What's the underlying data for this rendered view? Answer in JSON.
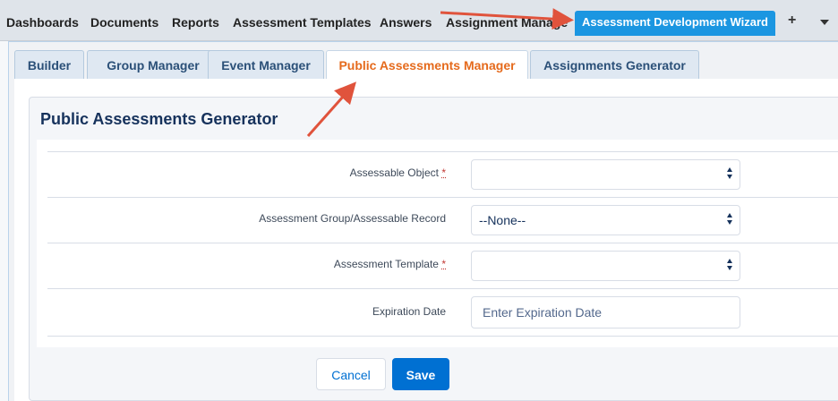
{
  "topnav": {
    "tabs": [
      "Dashboards",
      "Documents",
      "Reports",
      "Assessment Templates",
      "Answers",
      "Assignment Manage"
    ],
    "active_tab": "Assessment Development Wizard",
    "plus": "+",
    "active_color": "#1b96e1"
  },
  "subtabs": {
    "items": [
      "Builder",
      "Group Manager",
      "Event Manager",
      "Public Assessments Manager",
      "Assignments Generator"
    ],
    "active_color": "#e56a1c"
  },
  "form": {
    "title": "Public Assessments Generator",
    "required_marker": "*",
    "fields": [
      {
        "label": "Assessable Object",
        "value": ""
      },
      {
        "label": "Assessment Group/Assessable Record",
        "value": "--None--"
      },
      {
        "label": "Assessment Template",
        "value": ""
      },
      {
        "label": "Expiration Date",
        "placeholder": "Enter Expiration Date"
      }
    ]
  },
  "actions": {
    "cancel_label": "Cancel",
    "save_label": "Save",
    "primary_color": "#0070d2"
  },
  "annotations": {
    "arrow_color": "#e0533c"
  }
}
